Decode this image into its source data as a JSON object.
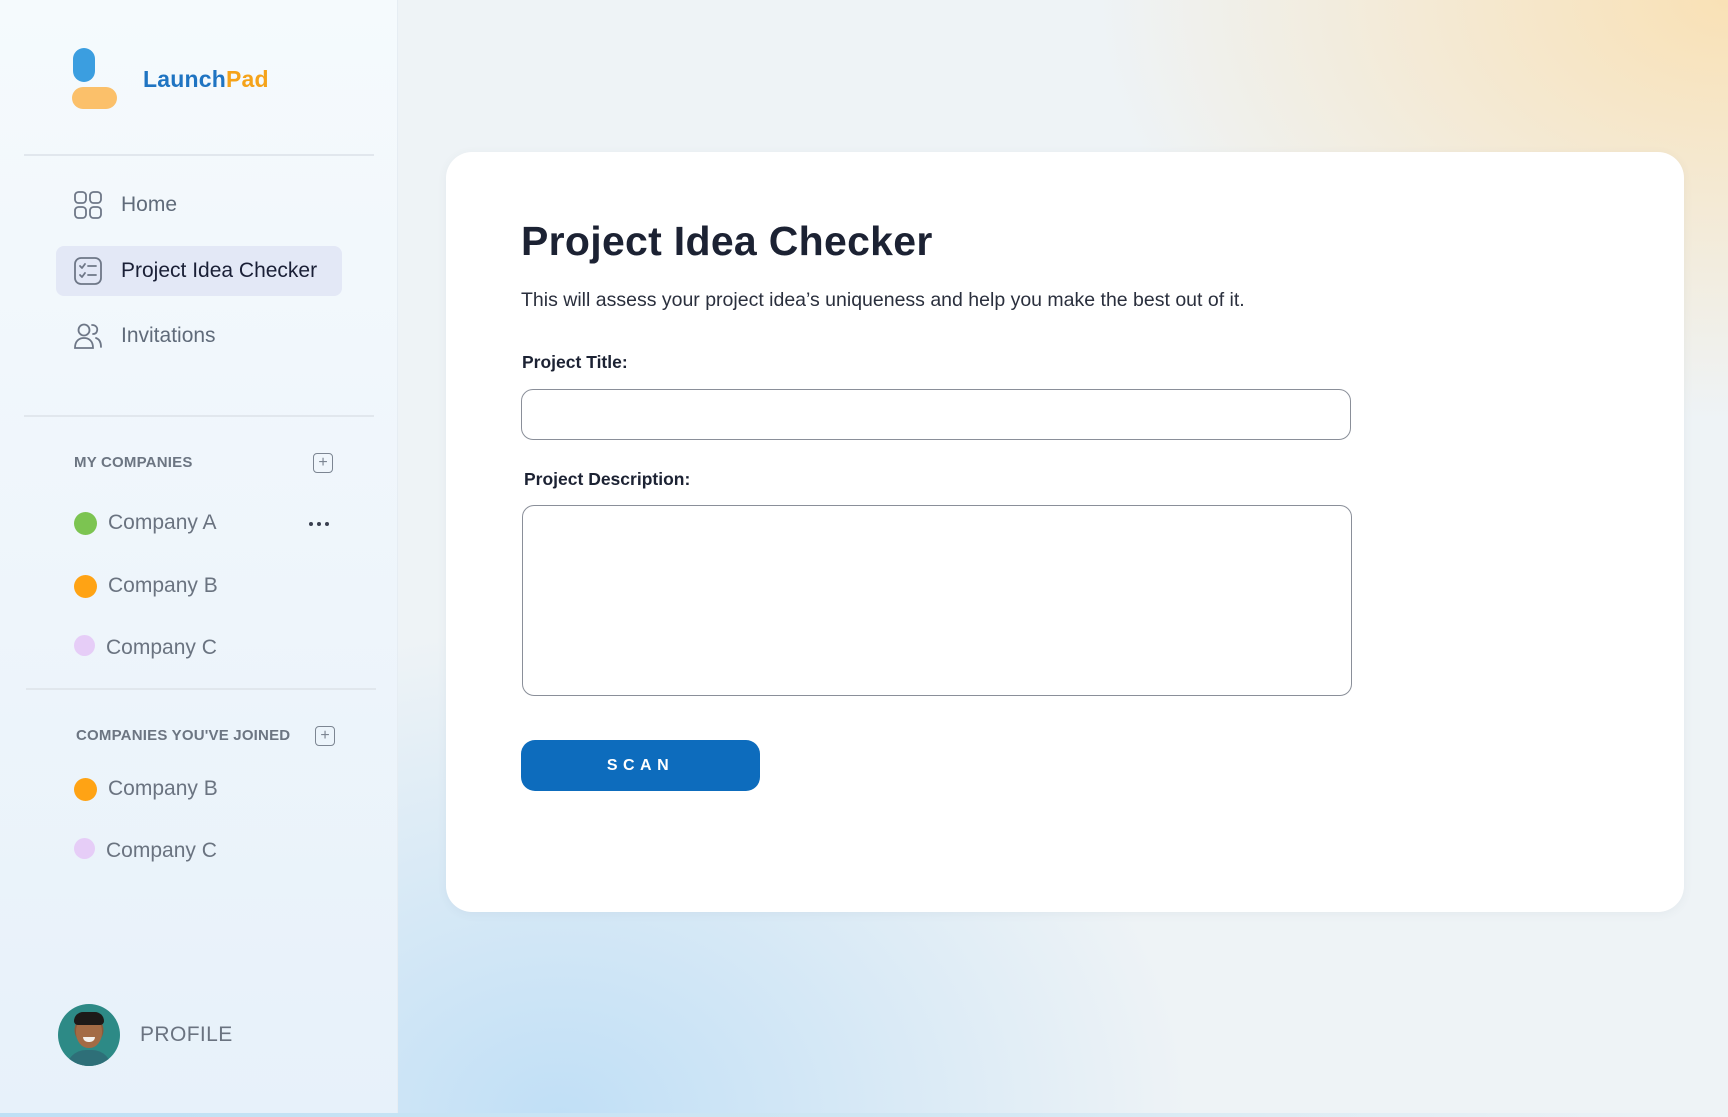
{
  "brand": {
    "name_part1": "Launch",
    "name_part2": "Pad",
    "color_part1": "#1f74c2",
    "color_part2": "#f5a31a"
  },
  "nav": {
    "items": [
      {
        "label": "Home",
        "icon": "grid-icon",
        "active": false
      },
      {
        "label": "Project Idea Checker",
        "icon": "checklist-icon",
        "active": true
      },
      {
        "label": "Invitations",
        "icon": "users-icon",
        "active": false
      }
    ]
  },
  "my_companies": {
    "title": "MY COMPANIES",
    "add_icon": "plus-square-icon",
    "more_icon": "ellipsis-icon",
    "items": [
      {
        "name": "Company A",
        "color": "#7cc451"
      },
      {
        "name": "Company B",
        "color": "#ffa314"
      },
      {
        "name": "Company C",
        "color": "#e6cdf7"
      }
    ]
  },
  "joined_companies": {
    "title": "COMPANIES YOU'VE JOINED",
    "add_icon": "plus-square-icon",
    "items": [
      {
        "name": "Company B",
        "color": "#ffa314"
      },
      {
        "name": "Company C",
        "color": "#e6cdf7"
      }
    ]
  },
  "profile": {
    "label": "PROFILE"
  },
  "main": {
    "title": "Project Idea Checker",
    "subtitle": "This will assess your project idea’s uniqueness and help you make the best out of it.",
    "title_field": {
      "label": "Project Title:",
      "value": "",
      "placeholder": ""
    },
    "description_field": {
      "label": "Project Description:",
      "value": "",
      "placeholder": ""
    },
    "scan_button": "SCAN",
    "accent_color": "#0d6cbd"
  }
}
